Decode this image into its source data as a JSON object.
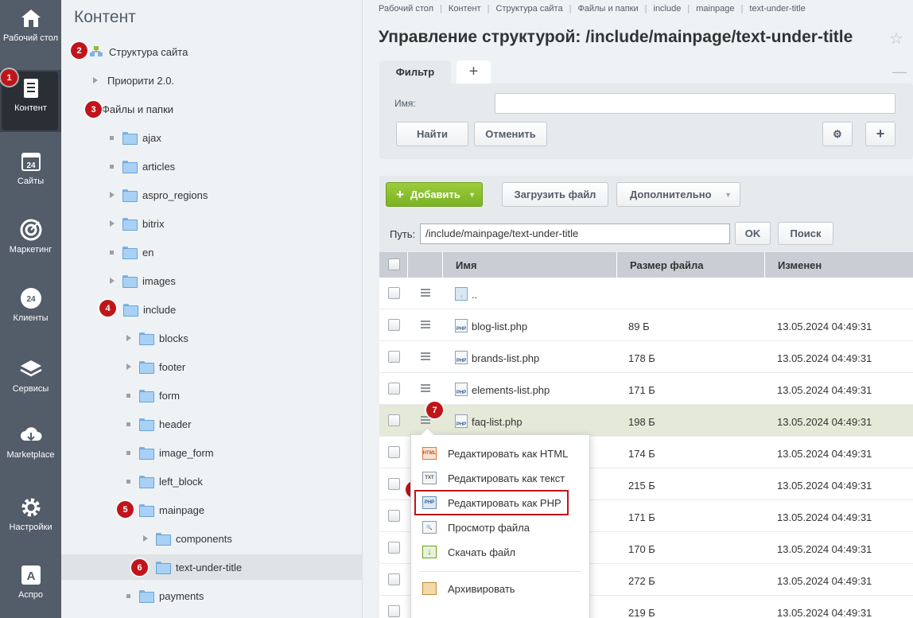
{
  "nav": {
    "items": [
      {
        "label": "Рабочий стол",
        "icon": "desktop-icon"
      },
      {
        "label": "Контент",
        "icon": "content-icon"
      },
      {
        "label": "Сайты",
        "icon": "sites-icon"
      },
      {
        "label": "Маркетинг",
        "icon": "target-icon"
      },
      {
        "label": "Клиенты",
        "icon": "clients-icon"
      },
      {
        "label": "Сервисы",
        "icon": "layers-icon"
      },
      {
        "label": "Marketplace",
        "icon": "cloud-download-icon"
      },
      {
        "label": "Настройки",
        "icon": "gear-icon"
      },
      {
        "label": "Аспро",
        "icon": "aspro-icon"
      }
    ]
  },
  "tree": {
    "title": "Контент",
    "items": [
      {
        "label": "Структура сайта"
      },
      {
        "label": "Приорити 2.0."
      },
      {
        "label": "Файлы и папки"
      },
      {
        "label": "ajax"
      },
      {
        "label": "articles"
      },
      {
        "label": "aspro_regions"
      },
      {
        "label": "bitrix"
      },
      {
        "label": "en"
      },
      {
        "label": "images"
      },
      {
        "label": "include"
      },
      {
        "label": "blocks"
      },
      {
        "label": "footer"
      },
      {
        "label": "form"
      },
      {
        "label": "header"
      },
      {
        "label": "image_form"
      },
      {
        "label": "left_block"
      },
      {
        "label": "mainpage"
      },
      {
        "label": "components"
      },
      {
        "label": "text-under-title"
      },
      {
        "label": "payments"
      }
    ]
  },
  "badges": [
    "1",
    "2",
    "3",
    "4",
    "5",
    "6",
    "7",
    "8"
  ],
  "breadcrumb": [
    "Рабочий стол",
    "Контент",
    "Структура сайта",
    "Файлы и папки",
    "include",
    "mainpage",
    "text-under-title"
  ],
  "page_title": "Управление структурой: /include/mainpage/text-under-title",
  "filter": {
    "tab": "Фильтр",
    "name_label": "Имя:",
    "name_value": "",
    "find": "Найти",
    "cancel": "Отменить"
  },
  "toolbar": {
    "add": "Добавить",
    "upload": "Загрузить файл",
    "more": "Дополнительно"
  },
  "path": {
    "label": "Путь:",
    "value": "/include/mainpage/text-under-title",
    "ok": "OK",
    "search": "Поиск"
  },
  "table": {
    "headers": [
      "Имя",
      "Размер файла",
      "Изменен"
    ],
    "rows": [
      {
        "name": "..",
        "size": "",
        "date": ""
      },
      {
        "name": "blog-list.php",
        "size": "89 Б",
        "date": "13.05.2024 04:49:31"
      },
      {
        "name": "brands-list.php",
        "size": "178 Б",
        "date": "13.05.2024 04:49:31"
      },
      {
        "name": "elements-list.php",
        "size": "171 Б",
        "date": "13.05.2024 04:49:31"
      },
      {
        "name": "faq-list.php",
        "size": "198 Б",
        "date": "13.05.2024 04:49:31"
      },
      {
        "name": "",
        "size": "174 Б",
        "date": "13.05.2024 04:49:31"
      },
      {
        "name": "",
        "size": "215 Б",
        "date": "13.05.2024 04:49:31"
      },
      {
        "name": "",
        "size": "171 Б",
        "date": "13.05.2024 04:49:31"
      },
      {
        "name": "",
        "size": "170 Б",
        "date": "13.05.2024 04:49:31"
      },
      {
        "name": "",
        "size": "272 Б",
        "date": "13.05.2024 04:49:31"
      },
      {
        "name": "",
        "size": "219 Б",
        "date": "13.05.2024 04:49:31"
      }
    ]
  },
  "context_menu": {
    "items": [
      {
        "label": "Редактировать как HTML",
        "icon": "HTML"
      },
      {
        "label": "Редактировать как текст",
        "icon": "TXT"
      },
      {
        "label": "Редактировать как PHP",
        "icon": "PHP"
      },
      {
        "label": "Просмотр файла",
        "icon": "view"
      },
      {
        "label": "Скачать файл",
        "icon": "download"
      },
      {
        "label": "Архивировать",
        "icon": "archive"
      }
    ]
  },
  "colors": {
    "nav_bg": "#535c69",
    "badge": "#c0141b",
    "add_green": "#8bbf2f",
    "highlight_row": "#e5e9d7"
  }
}
